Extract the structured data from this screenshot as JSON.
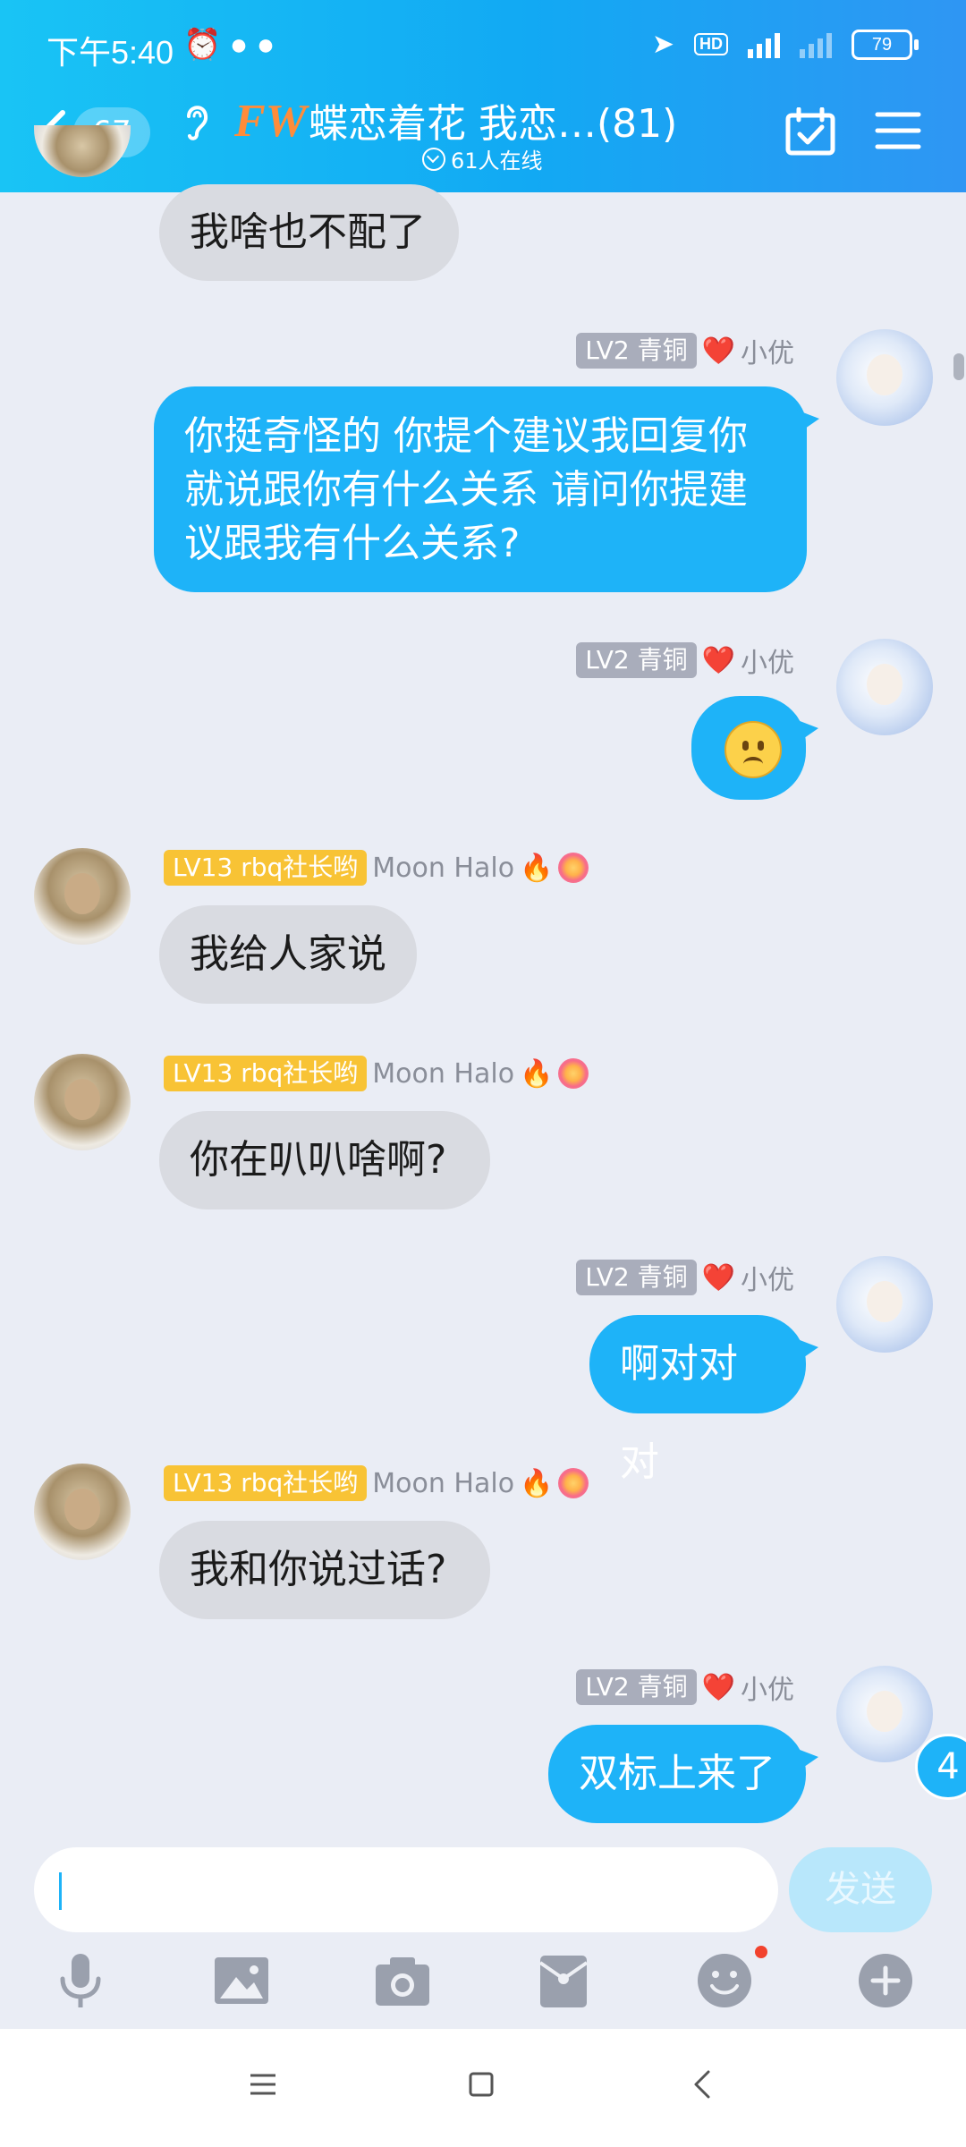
{
  "status_bar": {
    "time": "下午5:40",
    "battery": "79"
  },
  "header": {
    "back_count": "67",
    "logo_text": "FW",
    "group_title": "蝶恋着花 我恋…(81)",
    "online_text": "61人在线"
  },
  "messages": [
    {
      "side": "in",
      "text": "我啥也不配了"
    },
    {
      "side": "out",
      "level": "LV2 青铜",
      "heart": "❤️",
      "nick": "小优",
      "lines": [
        "你挺奇怪的 你提个建议我回复你",
        "就说跟你有什么关系 请问你提建",
        "议跟我有什么关系?"
      ]
    },
    {
      "side": "out",
      "level": "LV2 青铜",
      "heart": "❤️",
      "nick": "小优",
      "emoji": "sad-face"
    },
    {
      "side": "in",
      "level": "LV13 rbq社长哟",
      "nick": "Moon Halo",
      "text": "我给人家说"
    },
    {
      "side": "in",
      "level": "LV13 rbq社长哟",
      "nick": "Moon Halo",
      "text": "你在叭叭啥啊?"
    },
    {
      "side": "out",
      "level": "LV2 青铜",
      "heart": "❤️",
      "nick": "小优",
      "text": "啊对对对"
    },
    {
      "side": "in",
      "level": "LV13 rbq社长哟",
      "nick": "Moon Halo",
      "text": "我和你说过话?"
    },
    {
      "side": "out",
      "level": "LV2 青铜",
      "heart": "❤️",
      "nick": "小优",
      "text": "双标上来了"
    }
  ],
  "new_message_count": "4",
  "input": {
    "value": "",
    "send_label": "发送"
  },
  "toolbar": [
    "mic-icon",
    "image-icon",
    "camera-icon",
    "redpacket-icon",
    "emoji-icon",
    "plus-icon"
  ],
  "colors": {
    "header_start": "#19c4f5",
    "header_end": "#2f96f3",
    "bubble_out": "#1eb3f8",
    "bubble_in": "#d9dbe1",
    "badge_gold": "#f8c335",
    "badge_gray": "#a9adbb"
  }
}
